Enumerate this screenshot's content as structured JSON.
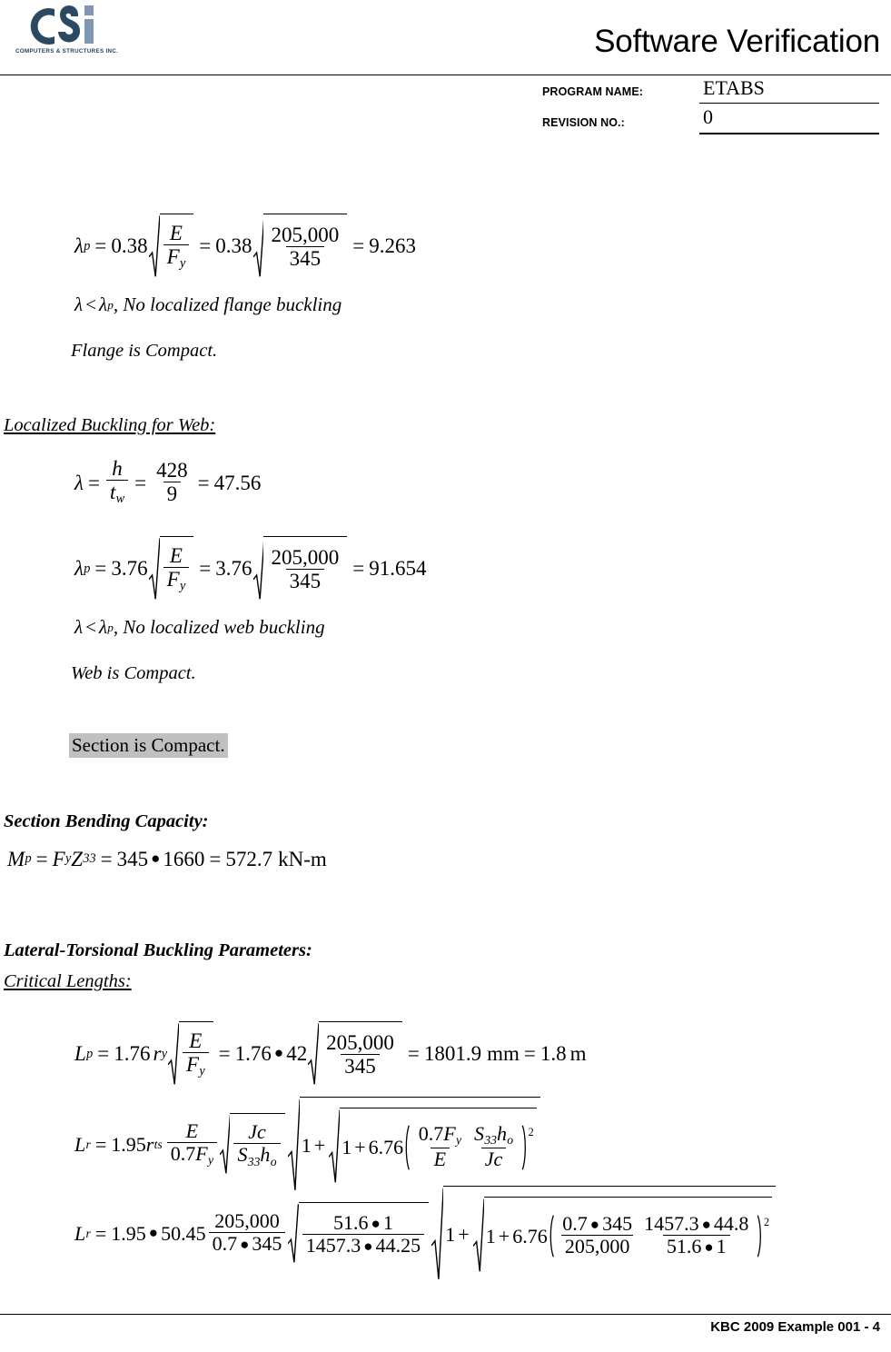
{
  "header": {
    "title": "Software Verification",
    "logo_text": "CSI",
    "logo_subtitle": "COMPUTERS & STRUCTURES INC.",
    "program_name_label": "PROGRAM NAME:",
    "program_name_value": "ETABS",
    "revision_label": "REVISION NO.:",
    "revision_value": "0"
  },
  "footer": {
    "text": "KBC 2009 Example 001 - 4"
  },
  "content": {
    "eq_lambda_p_flange": {
      "lhs": "λ",
      "lhs_sub": "p",
      "coef": "0.38",
      "E": "E",
      "Fy": "F",
      "Fy_sub": "y",
      "E_value": "205,000",
      "Fy_value": "345",
      "result": "9.263"
    },
    "flange_compare": {
      "lambda": "λ",
      "lt": "<",
      "lambda_p": "λ",
      "lambda_p_sub": "p",
      "text": ", No localized flange buckling"
    },
    "flange_conclusion": "Flange is Compact.",
    "web_heading": "Localized Buckling for Web:",
    "eq_lambda_web": {
      "lhs": "λ",
      "h": "h",
      "tw": "t",
      "tw_sub": "w",
      "h_value": "428",
      "tw_value": "9",
      "result": "47.56"
    },
    "eq_lambda_p_web": {
      "lhs": "λ",
      "lhs_sub": "p",
      "coef": "3.76",
      "E": "E",
      "Fy": "F",
      "Fy_sub": "y",
      "E_value": "205,000",
      "Fy_value": "345",
      "result": "91.654"
    },
    "web_compare": {
      "lambda": "λ",
      "lt": "<",
      "lambda_p": "λ",
      "lambda_p_sub": "p",
      "text": ", No localized web buckling"
    },
    "web_conclusion": "Web is Compact.",
    "section_compact": "Section is Compact.",
    "bending_heading": "Section Bending Capacity:",
    "eq_mp": {
      "Mp": "M",
      "Mp_sub": "p",
      "Fy": "F",
      "Fy_sub": "y",
      "Z": "Z",
      "Z_sub": "33",
      "Fy_value": "345",
      "Z_value": "1660",
      "result": "572.7",
      "unit": "kN-m"
    },
    "ltb_heading": "Lateral-Torsional Buckling Parameters:",
    "critical_lengths_heading": "Critical Lengths:",
    "eq_lp": {
      "L": "L",
      "L_sub": "p",
      "coef": "1.76",
      "ry": "r",
      "ry_sub": "y",
      "E": "E",
      "Fy": "F",
      "Fy_sub": "y",
      "ry_value": "42",
      "E_value": "205,000",
      "Fy_value": "345",
      "result_mm": "1801.9",
      "unit_mm": "mm",
      "result_m": "1.8",
      "unit_m": "m"
    },
    "eq_lr_symbolic": {
      "L": "L",
      "L_sub": "r",
      "coef": "1.95",
      "rts": "r",
      "rts_sub": "ts",
      "E": "E",
      "Fy_coef": "0.7",
      "Fy": "F",
      "Fy_sub": "y",
      "Jc": "Jc",
      "S33": "S",
      "S33_sub": "33",
      "ho": "h",
      "ho_sub": "o",
      "one": "1",
      "plus": "+",
      "const": "6.76",
      "exponent": "2"
    },
    "eq_lr_numeric": {
      "L": "L",
      "L_sub": "r",
      "coef": "1.95",
      "rts_value": "50.45",
      "E_value": "205,000",
      "Fy_num": "0.7",
      "Fy_value": "345",
      "Jc_num": "51.6",
      "Jc_c": "1",
      "S33_value": "1457.3",
      "ho_value": "44.25",
      "ho_value2": "44.8",
      "one": "1",
      "const": "6.76",
      "exponent": "2"
    }
  }
}
